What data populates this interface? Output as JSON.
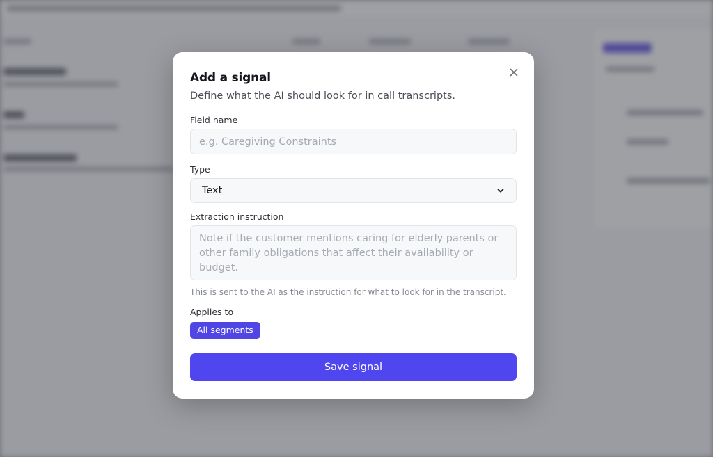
{
  "modal": {
    "title": "Add a signal",
    "subtitle": "Define what the AI should look for in call transcripts.",
    "close_icon": "close-icon",
    "field_name": {
      "label": "Field name",
      "value": "",
      "placeholder": "e.g. Caregiving Constraints"
    },
    "type": {
      "label": "Type",
      "selected": "Text",
      "icon": "chevron-down-icon"
    },
    "extraction_instruction": {
      "label": "Extraction instruction",
      "value": "",
      "placeholder": "Note if the customer mentions caring for elderly parents or other family obligations that affect their availability or budget.",
      "hint": "This is sent to the AI as the instruction for what to look for in the transcript."
    },
    "applies_to": {
      "label": "Applies to",
      "chip": "All segments"
    },
    "save_label": "Save signal"
  },
  "colors": {
    "accent": "#4f46e5",
    "overlay": "#50525a",
    "modal_bg": "#ffffff"
  }
}
